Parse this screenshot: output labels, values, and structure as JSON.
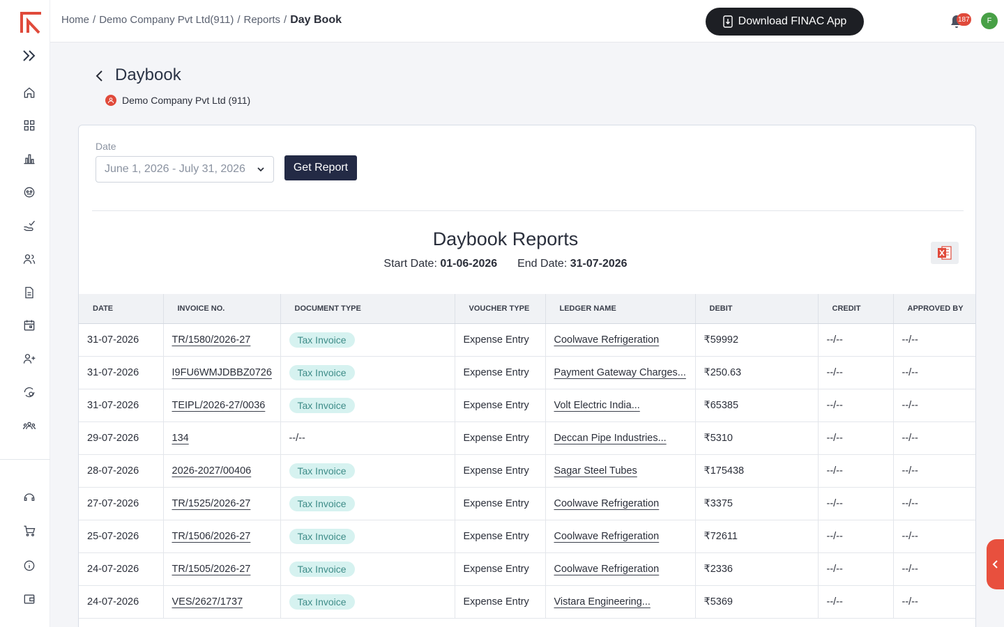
{
  "topbar": {
    "breadcrumb": [
      "Home",
      "Demo Company Pvt Ltd(911)",
      "Reports",
      "Day Book"
    ],
    "download_label": "Download FINAC App",
    "notification_count": "187",
    "avatar_initial": "F"
  },
  "sidebar": {
    "icons": [
      "home-icon",
      "grid-icon",
      "chart-icon",
      "dashboard-dial-icon",
      "hand-check-icon",
      "users-icon",
      "document-icon",
      "calendar-icon",
      "user-plus-icon",
      "settings-cycle-icon",
      "team-icon",
      "support-icon",
      "cart-icon",
      "info-icon",
      "wallet-icon"
    ]
  },
  "header": {
    "title": "Daybook",
    "company": "Demo Company Pvt Ltd (911)"
  },
  "filters": {
    "date_label": "Date",
    "date_range": "June 1, 2026 - July 31, 2026",
    "get_report_label": "Get Report"
  },
  "report": {
    "title": "Daybook Reports",
    "start_label": "Start Date:",
    "start_date": "01-06-2026",
    "end_label": "End Date:",
    "end_date": "31-07-2026"
  },
  "table": {
    "columns": [
      "DATE",
      "INVOICE NO.",
      "DOCUMENT TYPE",
      "VOUCHER TYPE",
      "LEDGER NAME",
      "DEBIT",
      "CREDIT",
      "APPROVED BY"
    ],
    "rows": [
      {
        "date": "31-07-2026",
        "invoice": "TR/1580/2026-27",
        "doc_type": "Tax Invoice",
        "voucher": "Expense Entry",
        "ledger": "Coolwave Refrigeration",
        "debit": "₹59992",
        "credit": "--/--",
        "approved": "--/--"
      },
      {
        "date": "31-07-2026",
        "invoice": "I9FU6WMJDBBZ0726",
        "doc_type": "Tax Invoice",
        "voucher": "Expense Entry",
        "ledger": "Payment Gateway Charges...",
        "debit": "₹250.63",
        "credit": "--/--",
        "approved": "--/--"
      },
      {
        "date": "31-07-2026",
        "invoice": "TEIPL/2026-27/0036",
        "doc_type": "Tax Invoice",
        "voucher": "Expense Entry",
        "ledger": "Volt Electric India...",
        "debit": "₹65385",
        "credit": "--/--",
        "approved": "--/--"
      },
      {
        "date": "29-07-2026",
        "invoice": "134",
        "doc_type": "--/--",
        "voucher": "Expense Entry",
        "ledger": "Deccan Pipe Industries...",
        "debit": "₹5310",
        "credit": "--/--",
        "approved": "--/--"
      },
      {
        "date": "28-07-2026",
        "invoice": "2026-2027/00406",
        "doc_type": "Tax Invoice",
        "voucher": "Expense Entry",
        "ledger": "Sagar Steel Tubes",
        "debit": "₹175438",
        "credit": "--/--",
        "approved": "--/--"
      },
      {
        "date": "27-07-2026",
        "invoice": "TR/1525/2026-27",
        "doc_type": "Tax Invoice",
        "voucher": "Expense Entry",
        "ledger": "Coolwave Refrigeration",
        "debit": "₹3375",
        "credit": "--/--",
        "approved": "--/--"
      },
      {
        "date": "25-07-2026",
        "invoice": "TR/1506/2026-27",
        "doc_type": "Tax Invoice",
        "voucher": "Expense Entry",
        "ledger": "Coolwave Refrigeration",
        "debit": "₹72611",
        "credit": "--/--",
        "approved": "--/--"
      },
      {
        "date": "24-07-2026",
        "invoice": "TR/1505/2026-27",
        "doc_type": "Tax Invoice",
        "voucher": "Expense Entry",
        "ledger": "Coolwave Refrigeration",
        "debit": "₹2336",
        "credit": "--/--",
        "approved": "--/--"
      },
      {
        "date": "24-07-2026",
        "invoice": "VES/2627/1737",
        "doc_type": "Tax Invoice",
        "voucher": "Expense Entry",
        "ledger": "Vistara Engineering...",
        "debit": "₹5369",
        "credit": "--/--",
        "approved": "--/--"
      }
    ]
  },
  "colors": {
    "brand": "#e04a3b",
    "primary_button": "#232a45",
    "pill_bg": "#d6f2f0",
    "pill_text": "#3e8c88"
  }
}
